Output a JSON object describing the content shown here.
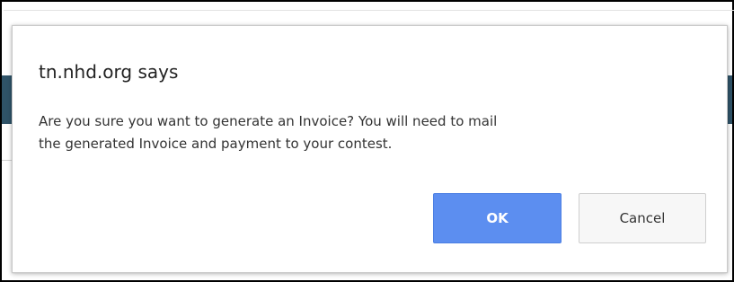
{
  "dialog": {
    "title": "tn.nhd.org says",
    "message_lines": [
      "Are you sure you want to generate an Invoice? You will need to mail",
      "the generated Invoice and payment to your contest."
    ],
    "ok_label": "OK",
    "cancel_label": "Cancel"
  },
  "colors": {
    "ok_button": "#5c8ef0",
    "background_strip": "#2f5368"
  }
}
